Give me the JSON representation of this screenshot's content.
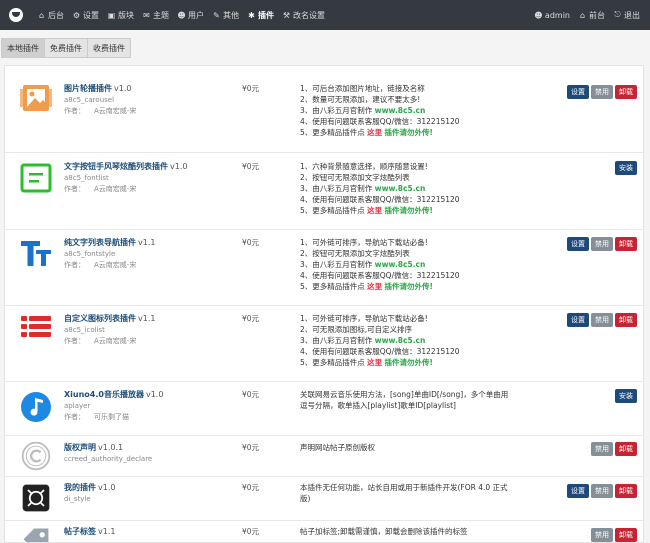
{
  "topnav": {
    "items": [
      {
        "icon": "home-icon",
        "glyph": "⌂",
        "label": "后台"
      },
      {
        "icon": "settings-icon",
        "glyph": "⚙",
        "label": "设置"
      },
      {
        "icon": "block-icon",
        "glyph": "▣",
        "label": "版块"
      },
      {
        "icon": "topic-icon",
        "glyph": "✉",
        "label": "主题"
      },
      {
        "icon": "user-icon",
        "glyph": "☻",
        "label": "用户"
      },
      {
        "icon": "wrench-icon",
        "glyph": "✎",
        "label": "其他"
      },
      {
        "icon": "plugin-icon",
        "glyph": "✱",
        "label": "插件"
      },
      {
        "icon": "theme-icon",
        "glyph": "⚒",
        "label": "改名设置"
      }
    ],
    "right": [
      {
        "icon": "admin-icon",
        "glyph": "☻",
        "label": "admin"
      },
      {
        "icon": "frontend-icon",
        "glyph": "⌂",
        "label": "前台"
      },
      {
        "icon": "logout-icon",
        "glyph": "⎋",
        "label": "退出"
      }
    ]
  },
  "tabs": [
    "本地插件",
    "免费插件",
    "收费插件"
  ],
  "plugins": [
    {
      "name": "图片轮播插件",
      "version": "v1.0",
      "key": "a8c5_carousel",
      "author_label": "作者：",
      "author": "A云南宏威-宋",
      "price": "¥0元",
      "desc": [
        "1、可后台添加图片地址，链接及名称",
        "2、数量可无限添加，建议不要太多!",
        "3、由八彩五月官制作  www.8c5.cn",
        "4、使用有问题联系客服QQ/微信：312215120",
        "5、更多精品插件点 这里  插件请勿外传!"
      ],
      "buttons": [
        "设置",
        "禁用",
        "卸载"
      ]
    },
    {
      "name": "文字按钮手风琴炫酷列表插件",
      "version": "v1.0",
      "key": "a8c5_fontlist",
      "author_label": "作者：",
      "author": "A云南宏威-宋",
      "price": "¥0元",
      "desc": [
        "1、六种背景随意选择，顺序随意设置!",
        "2、按钮可无限添加文字炫酷列表",
        "3、由八彩五月官制作  www.8c5.cn",
        "4、使用有问题联系客服QQ/微信：312215120",
        "5、更多精品插件点 这里  插件请勿外传!"
      ],
      "buttons": [
        "安装"
      ]
    },
    {
      "name": "纯文字列表导航插件",
      "version": "v1.1",
      "key": "a8c5_fontstyle",
      "author_label": "作者：",
      "author": "A云南宏威-宋",
      "price": "¥0元",
      "desc": [
        "1、可外链可排序，导航站下载站必备!",
        "2、按钮可无限添加文字炫酷列表",
        "3、由八彩五月官制作  www.8c5.cn",
        "4、使用有问题联系客服QQ/微信：312215120",
        "5、更多精品插件点 这里  插件请勿外传!"
      ],
      "buttons": [
        "设置",
        "禁用",
        "卸载"
      ]
    },
    {
      "name": "自定义图标列表插件",
      "version": "v1.1",
      "key": "a8c5_icolist",
      "author_label": "作者：",
      "author": "A云南宏威-宋",
      "price": "¥0元",
      "desc": [
        "1、可外链可排序，导航站下载站必备!",
        "2、可无限添加图标,可自定义排序",
        "3、由八彩五月官制作  www.8c5.cn",
        "4、使用有问题联系客服QQ/微信：312215120",
        "5、更多精品插件点 这里  插件请勿外传!"
      ],
      "buttons": [
        "设置",
        "禁用",
        "卸载"
      ]
    },
    {
      "name": "Xiuno4.0音乐播放器",
      "version": "v1.0",
      "key": "aplayer",
      "author_label": "作者：",
      "author": "可乐剩了猫",
      "price": "¥0元",
      "desc": [
        "关联网易云音乐使用方法，[song]单曲ID[/song]，多个单曲用逗号分隔，歌单插入[playlist]歌单ID[playlist]"
      ],
      "buttons": [
        "安装"
      ]
    },
    {
      "name": "版权声明",
      "version": "v1.0.1",
      "key": "ccreed_authority_declare",
      "author_label": "",
      "author": "",
      "price": "¥0元",
      "desc": [
        "声明网站帖子原创版权"
      ],
      "buttons": [
        "禁用",
        "卸载"
      ]
    },
    {
      "name": "我的插件",
      "version": "v1.0",
      "key": "di_style",
      "author_label": "",
      "author": "",
      "price": "¥0元",
      "desc": [
        "本插件无任何功能，站长自用或用于新插件开发(FOR 4.0 正式版)"
      ],
      "buttons": [
        "设置",
        "禁用",
        "卸载"
      ]
    },
    {
      "name": "帖子标签",
      "version": "v1.1",
      "key": "",
      "author_label": "",
      "author": "",
      "price": "¥0元",
      "desc": [
        "帖子加标签;卸载需谨慎，卸载会删除该插件的标签"
      ],
      "buttons": [
        "禁用",
        "卸载"
      ]
    }
  ],
  "colors": {
    "topbar": "#343a40",
    "link": "#1f4e79",
    "green": "#28a745",
    "red": "#dc3545",
    "primary": "#1e4a7a",
    "gray": "#868e96"
  }
}
